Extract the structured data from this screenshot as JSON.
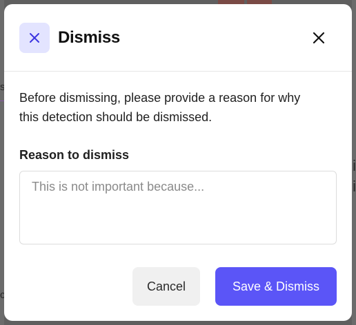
{
  "dialog": {
    "title": "Dismiss",
    "description": "Before dismissing, please provide a reason for why this detection should be dismissed.",
    "reason_label": "Reason to dismiss",
    "reason_value": "",
    "reason_placeholder": "This is not important because...",
    "cancel_label": "Cancel",
    "confirm_label": "Save & Dismiss",
    "header_icon": "x-icon",
    "close_icon": "close-icon"
  },
  "colors": {
    "accent": "#5b55f7",
    "icon_bg": "#e3e4ff",
    "overlay": "#5f5f5f"
  },
  "background": {
    "glyphs": [
      "s",
      "i",
      "i",
      "c"
    ]
  }
}
